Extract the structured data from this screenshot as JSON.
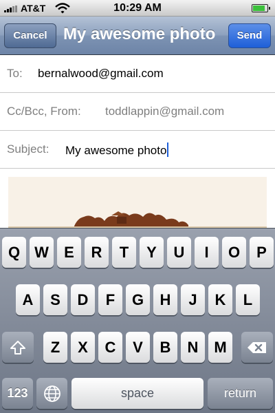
{
  "status_bar": {
    "carrier": "AT&T",
    "time": "10:29 AM",
    "battery_level": 0.85
  },
  "nav": {
    "cancel_label": "Cancel",
    "title": "My awesome photo",
    "send_label": "Send"
  },
  "compose": {
    "to_label": "To:",
    "to_value": "bernalwood@gmail.com",
    "ccbcc_label": "Cc/Bcc, From:",
    "from_value": "toddlappin@gmail.com",
    "subject_label": "Subject:",
    "subject_value": "My awesome photo"
  },
  "keyboard": {
    "row1": [
      "Q",
      "W",
      "E",
      "R",
      "T",
      "Y",
      "U",
      "I",
      "O",
      "P"
    ],
    "row2": [
      "A",
      "S",
      "D",
      "F",
      "G",
      "H",
      "J",
      "K",
      "L"
    ],
    "row3": [
      "Z",
      "X",
      "C",
      "V",
      "B",
      "N",
      "M"
    ],
    "numbers_label": "123",
    "space_label": "space",
    "return_label": "return",
    "icons": {
      "shift": "shift-icon",
      "delete": "delete-icon",
      "globe": "globe-icon"
    }
  }
}
